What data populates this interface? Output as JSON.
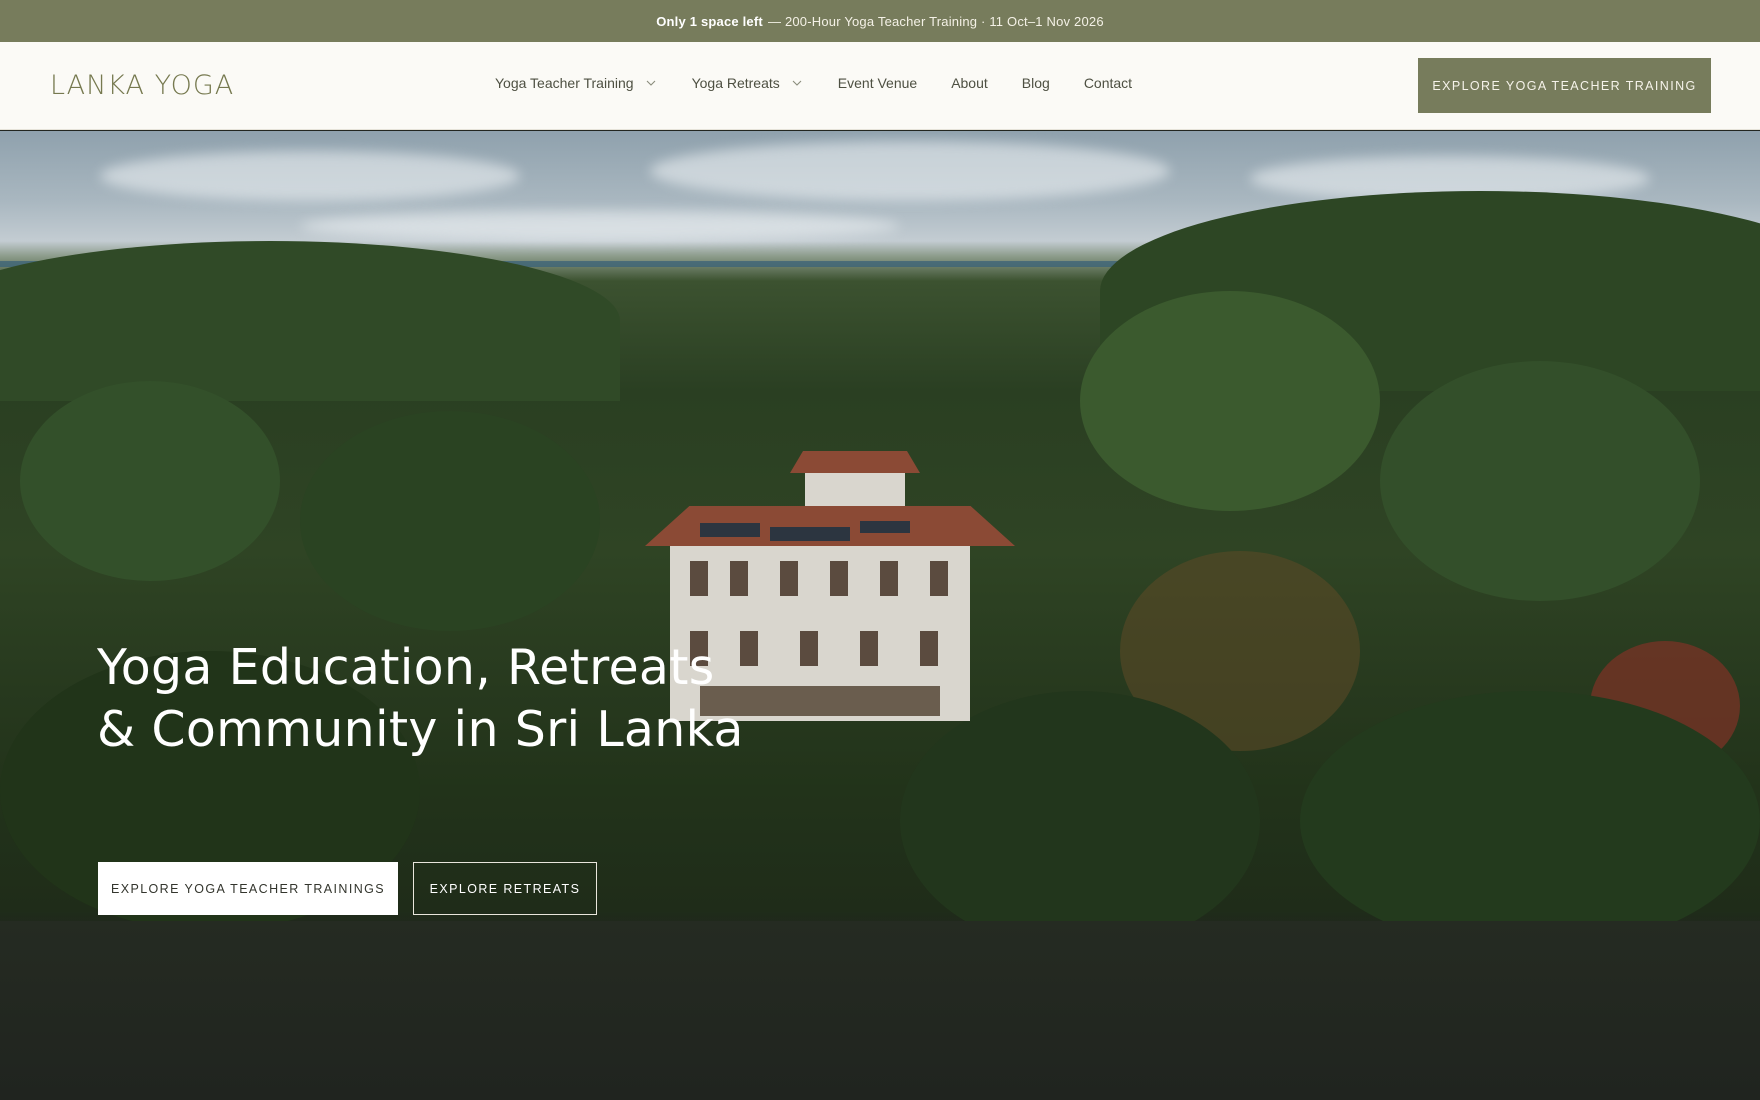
{
  "announcement": {
    "highlight": "Only 1 space left",
    "text": "— 200-Hour Yoga Teacher Training · 11 Oct–1 Nov 2026"
  },
  "header": {
    "logo": "LANKA YOGA",
    "nav": [
      {
        "label": "Yoga Teacher Training",
        "has_dropdown": true
      },
      {
        "label": "Yoga Retreats",
        "has_dropdown": true
      },
      {
        "label": "Event Venue",
        "has_dropdown": false
      },
      {
        "label": "About",
        "has_dropdown": false
      },
      {
        "label": "Blog",
        "has_dropdown": false
      },
      {
        "label": "Contact",
        "has_dropdown": false
      }
    ],
    "cta_label": "EXPLORE YOGA TEACHER TRAINING"
  },
  "hero": {
    "title_line1": "Yoga Education, Retreats",
    "title_line2": "& Community in Sri Lanka",
    "primary_button": "EXPLORE YOGA TEACHER TRAININGS",
    "secondary_button": "EXPLORE RETREATS"
  },
  "colors": {
    "brand_olive": "#777c5c",
    "header_bg": "#fbfaf6",
    "logo": "#76794f"
  },
  "icons": {
    "dropdown": "chevron-down-icon"
  }
}
